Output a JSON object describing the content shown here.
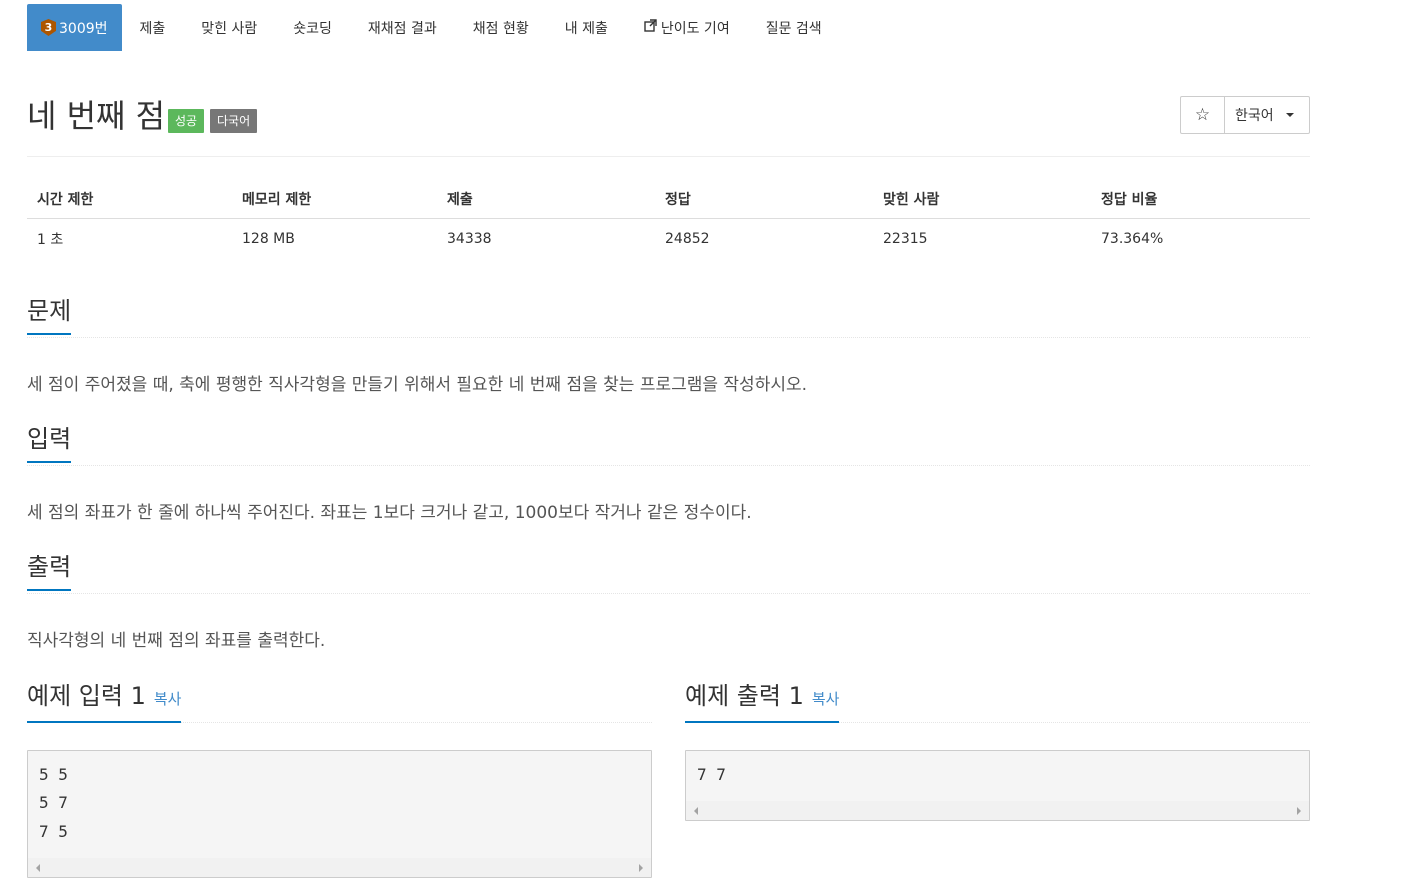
{
  "nav": {
    "tier": "3",
    "problem_number": "3009번",
    "tabs": [
      "제출",
      "맞힌 사람",
      "숏코딩",
      "재채점 결과",
      "채점 현황",
      "내 제출",
      "난이도 기여",
      "질문 검색"
    ]
  },
  "problem": {
    "title": "네 번째 점",
    "label_success": "성공",
    "label_multilang": "다국어",
    "star_icon": "☆",
    "language_select": "한국어"
  },
  "info": {
    "headers": [
      "시간 제한",
      "메모리 제한",
      "제출",
      "정답",
      "맞힌 사람",
      "정답 비율"
    ],
    "values": [
      "1 초",
      "128 MB",
      "34338",
      "24852",
      "22315",
      "73.364%"
    ]
  },
  "sections": {
    "problem_title": "문제",
    "problem_text": "세 점이 주어졌을 때, 축에 평행한 직사각형을 만들기 위해서 필요한 네 번째 점을 찾는 프로그램을 작성하시오.",
    "input_title": "입력",
    "input_text": "세 점의 좌표가 한 줄에 하나씩 주어진다. 좌표는 1보다 크거나 같고, 1000보다 작거나 같은 정수이다.",
    "output_title": "출력",
    "output_text": "직사각형의 네 번째 점의 좌표를 출력한다."
  },
  "examples": {
    "input_title": "예제 입력 1",
    "output_title": "예제 출력 1",
    "copy_label": "복사",
    "input_lines": [
      "5 5",
      "5 7",
      "7 5"
    ],
    "output_lines": [
      "7 7"
    ]
  },
  "colors": {
    "primary": "#428bca",
    "success": "#5cb85c",
    "tier_bronze": "#ad5600",
    "section_underline": "#0076c0"
  }
}
